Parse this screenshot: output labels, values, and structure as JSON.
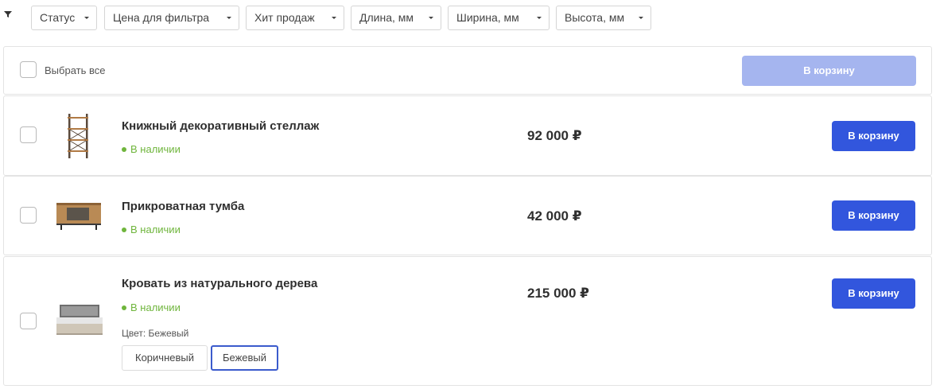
{
  "filters": [
    {
      "label": "Статус"
    },
    {
      "label": "Цена для фильтра"
    },
    {
      "label": "Хит продаж"
    },
    {
      "label": "Длина, мм"
    },
    {
      "label": "Ширина, мм"
    },
    {
      "label": "Высота, мм"
    }
  ],
  "select_all": {
    "label": "Выбрать все",
    "button_label": "В корзину"
  },
  "products": [
    {
      "name": "Книжный декоративный стеллаж",
      "stock": "В наличии",
      "price": "92 000 ₽",
      "button_label": "В корзину",
      "image_icon": "shelf-image"
    },
    {
      "name": "Прикроватная тумба",
      "stock": "В наличии",
      "price": "42 000 ₽",
      "button_label": "В корзину",
      "image_icon": "nightstand-image"
    },
    {
      "name": "Кровать из натурального дерева",
      "stock": "В наличии",
      "price": "215 000 ₽",
      "button_label": "В корзину",
      "image_icon": "bed-image",
      "color_label": "Цвет: Бежевый",
      "variants": [
        {
          "label": "Коричневый",
          "selected": false
        },
        {
          "label": "Бежевый",
          "selected": true
        }
      ]
    }
  ],
  "colors": {
    "primary_button": "#3256dd",
    "disabled_button": "#a5b5ef",
    "in_stock": "#6fb53c",
    "selected_variant_border": "#3b5bcc"
  }
}
